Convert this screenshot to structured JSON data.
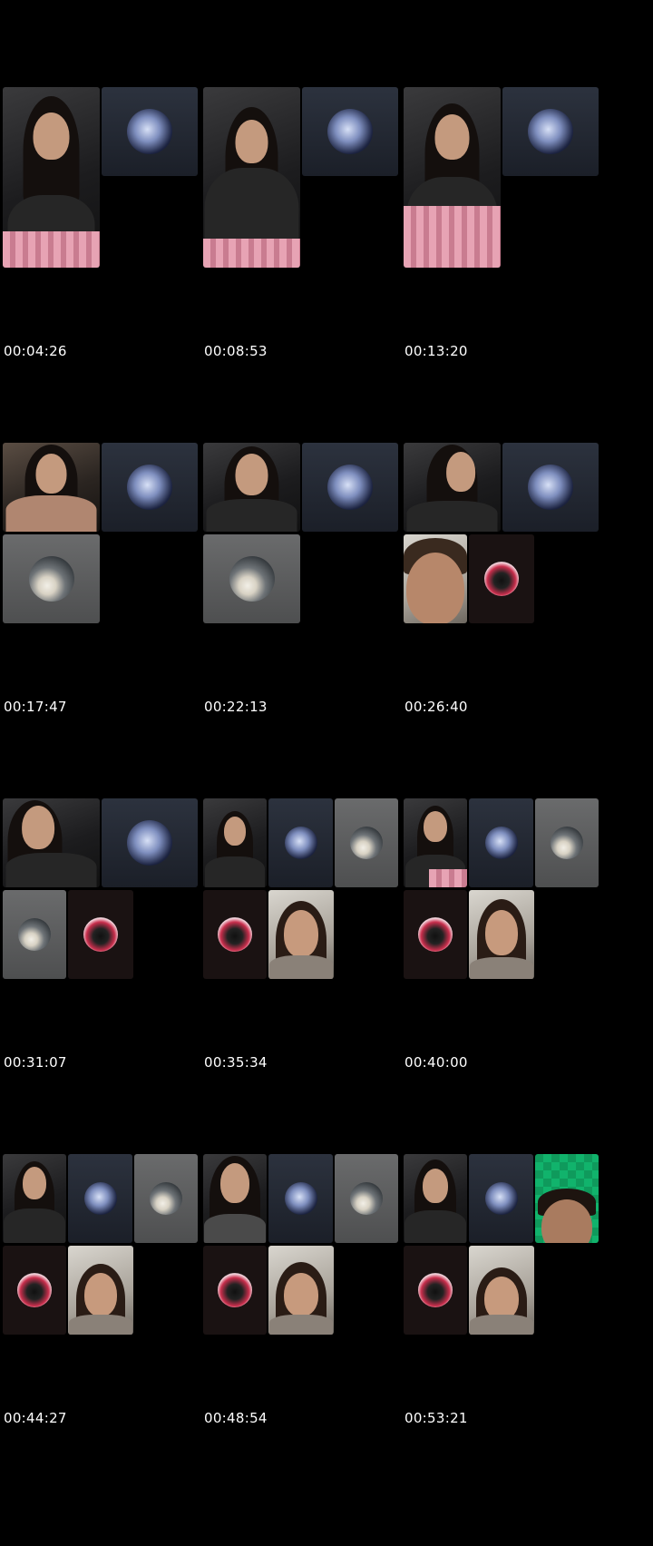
{
  "sheet": {
    "frames": [
      {
        "timestamp": "00:04:26"
      },
      {
        "timestamp": "00:08:53"
      },
      {
        "timestamp": "00:13:20"
      },
      {
        "timestamp": "00:17:47"
      },
      {
        "timestamp": "00:22:13"
      },
      {
        "timestamp": "00:26:40"
      },
      {
        "timestamp": "00:31:07"
      },
      {
        "timestamp": "00:35:34"
      },
      {
        "timestamp": "00:40:00"
      },
      {
        "timestamp": "00:44:27"
      },
      {
        "timestamp": "00:48:54"
      },
      {
        "timestamp": "00:53:21"
      }
    ]
  },
  "colors": {
    "background": "#000000",
    "timestamp_text": "#ffffff",
    "navy_tile": "#2c323e",
    "grey_tile": "#5c5d5e",
    "dark_tile": "#1a1212",
    "green_screen": "#11b36c"
  },
  "icons": [
    "avatar-blue-portrait",
    "avatar-car-dog",
    "avatar-red-circle"
  ]
}
